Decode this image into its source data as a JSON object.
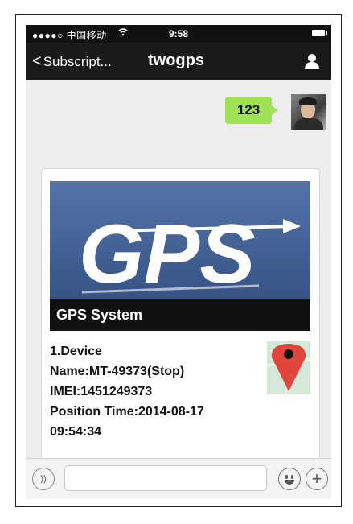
{
  "status_bar": {
    "carrier": "●●●●○ 中国移动",
    "time": "9:58"
  },
  "nav": {
    "back_label": "Subscript...",
    "title": "twogps"
  },
  "chat": {
    "sent_message": "123",
    "card": {
      "banner_logo_text": "GPS",
      "banner_title": "GPS System",
      "line1": "1.Device",
      "line2": "Name:MT-49373(Stop)",
      "line3": "IMEI:1451249373",
      "line4": "Position Time:2014-08-17",
      "line5": "09:54:34"
    }
  },
  "input_bar": {
    "placeholder": "",
    "voice_icon_glyph": "))"
  },
  "colors": {
    "bubble": "#9fe256",
    "banner": "#3f5f95",
    "map_pin": "#e0463c"
  }
}
